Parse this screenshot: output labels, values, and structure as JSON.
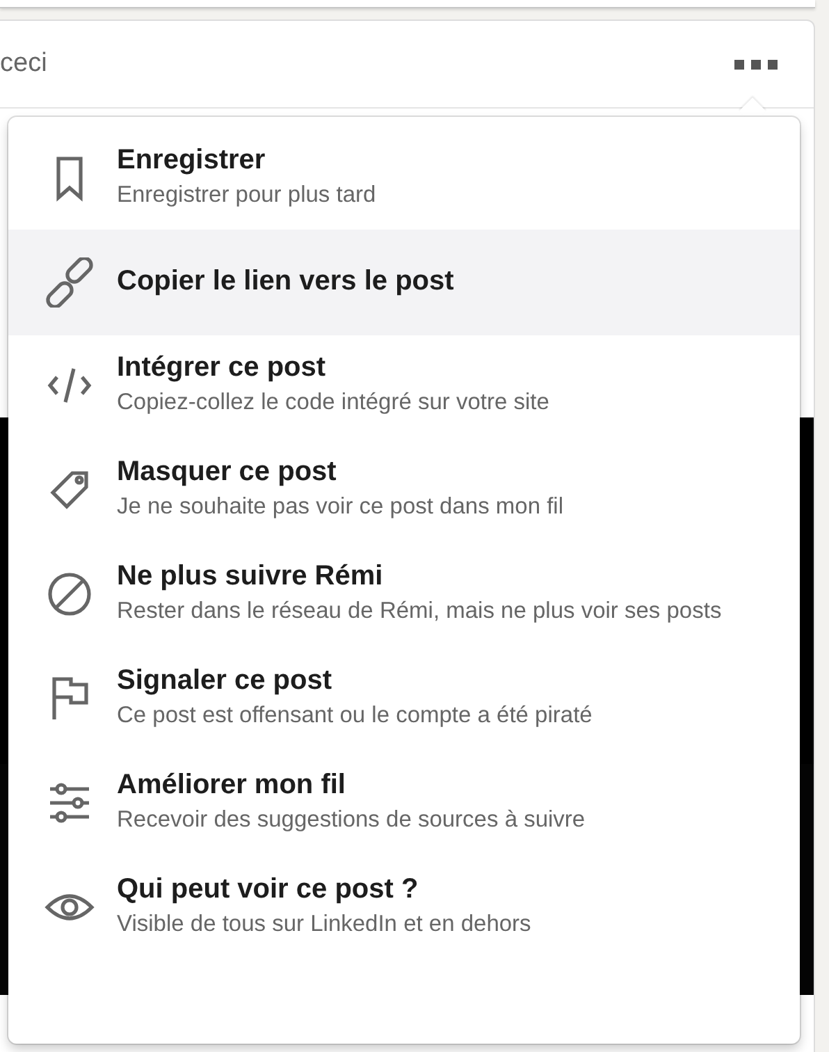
{
  "post_header": {
    "text": "ceci"
  },
  "menu": {
    "items": [
      {
        "title": "Enregistrer",
        "subtitle": "Enregistrer pour plus tard",
        "highlighted": false
      },
      {
        "title": "Copier le lien vers le post",
        "highlighted": true
      },
      {
        "title": "Intégrer ce post",
        "subtitle": "Copiez-collez le code intégré sur votre site",
        "highlighted": false
      },
      {
        "title": "Masquer ce post",
        "subtitle": "Je ne souhaite pas voir ce post dans mon fil",
        "highlighted": false
      },
      {
        "title": "Ne plus suivre Rémi",
        "subtitle": "Rester dans le réseau de Rémi, mais ne plus voir ses posts",
        "highlighted": false
      },
      {
        "title": "Signaler ce post",
        "subtitle": "Ce post est offensant ou le compte a été piraté",
        "highlighted": false
      },
      {
        "title": "Améliorer mon fil",
        "subtitle": "Recevoir des suggestions de sources à suivre",
        "highlighted": false
      },
      {
        "title": "Qui peut voir ce post ?",
        "subtitle": "Visible de tous sur LinkedIn et en dehors",
        "highlighted": false
      }
    ]
  }
}
